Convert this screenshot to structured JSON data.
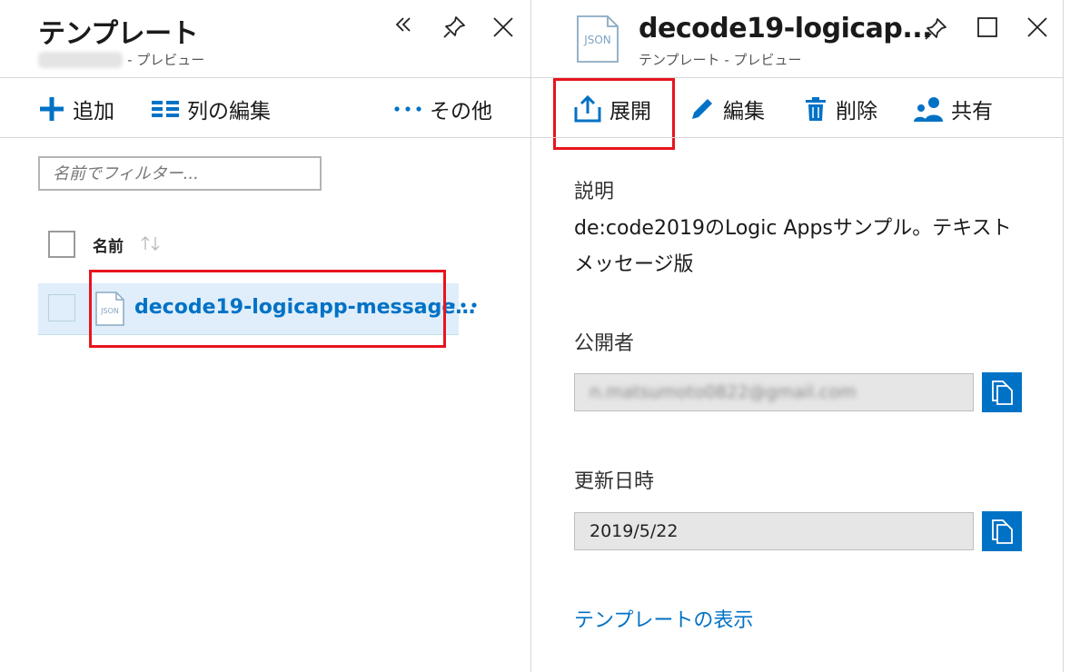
{
  "left_blade": {
    "title": "テンプレート",
    "subtitle_owner": "owner-name",
    "subtitle_suffix": " - プレビュー",
    "commands": {
      "add": "追加",
      "edit_columns": "列の編集",
      "more": "その他"
    },
    "filter_placeholder": "名前でフィルター...",
    "column_name": "名前",
    "rows": [
      {
        "name": "decode19-logicapp-message…",
        "file_icon_text": "JSON"
      }
    ]
  },
  "right_blade": {
    "title": "decode19-logicap...",
    "subtitle": "テンプレート - プレビュー",
    "file_icon_text": "JSON",
    "commands": {
      "deploy": "展開",
      "edit": "編集",
      "delete": "削除",
      "share": "共有"
    },
    "description_label": "説明",
    "description_text": "de:code2019のLogic Appsサンプル。テキストメッセージ版",
    "publisher_label": "公開者",
    "publisher_value": "n.matsumoto0822@gmail.com",
    "updated_label": "更新日時",
    "updated_value": "2019/5/22",
    "view_template_link": "テンプレートの表示"
  },
  "colors": {
    "accent": "#0072c6",
    "highlight": "#e8141e",
    "selected_row": "#dfeefa"
  }
}
